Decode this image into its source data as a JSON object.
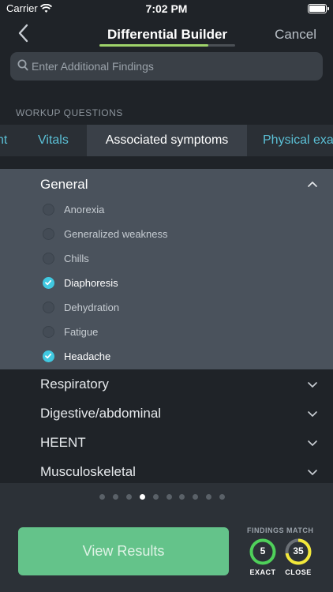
{
  "status_bar": {
    "carrier": "Carrier",
    "time": "7:02 PM"
  },
  "nav": {
    "title": "Differential Builder",
    "cancel": "Cancel",
    "progress": 0.8
  },
  "search": {
    "placeholder": "Enter Additional Findings"
  },
  "section_label": "WORKUP QUESTIONS",
  "tabs": [
    {
      "label": "nt"
    },
    {
      "label": "Vitals"
    },
    {
      "label": "Associated symptoms",
      "active": true
    },
    {
      "label": "Physical exa"
    }
  ],
  "open_category": {
    "title": "General",
    "items": [
      {
        "label": "Anorexia",
        "checked": false
      },
      {
        "label": "Generalized weakness",
        "checked": false
      },
      {
        "label": "Chills",
        "checked": false
      },
      {
        "label": "Diaphoresis",
        "checked": true
      },
      {
        "label": "Dehydration",
        "checked": false
      },
      {
        "label": "Fatigue",
        "checked": false
      },
      {
        "label": "Headache",
        "checked": true
      }
    ]
  },
  "categories": [
    {
      "title": "Respiratory"
    },
    {
      "title": "Digestive/abdominal"
    },
    {
      "title": "HEENT"
    },
    {
      "title": "Musculoskeletal"
    }
  ],
  "pager": {
    "count": 10,
    "active_index": 3
  },
  "view_results": "View Results",
  "findings_match": {
    "label": "FINDINGS MATCH",
    "exact": {
      "value": "5",
      "caption": "EXACT",
      "color": "#4fd05a"
    },
    "close": {
      "value": "35",
      "caption": "CLOSE",
      "color": "#f2e83a"
    }
  },
  "colors": {
    "accent_cyan": "#40c8e0",
    "button_green": "#64c38a",
    "progress_green": "#9ed36a"
  }
}
